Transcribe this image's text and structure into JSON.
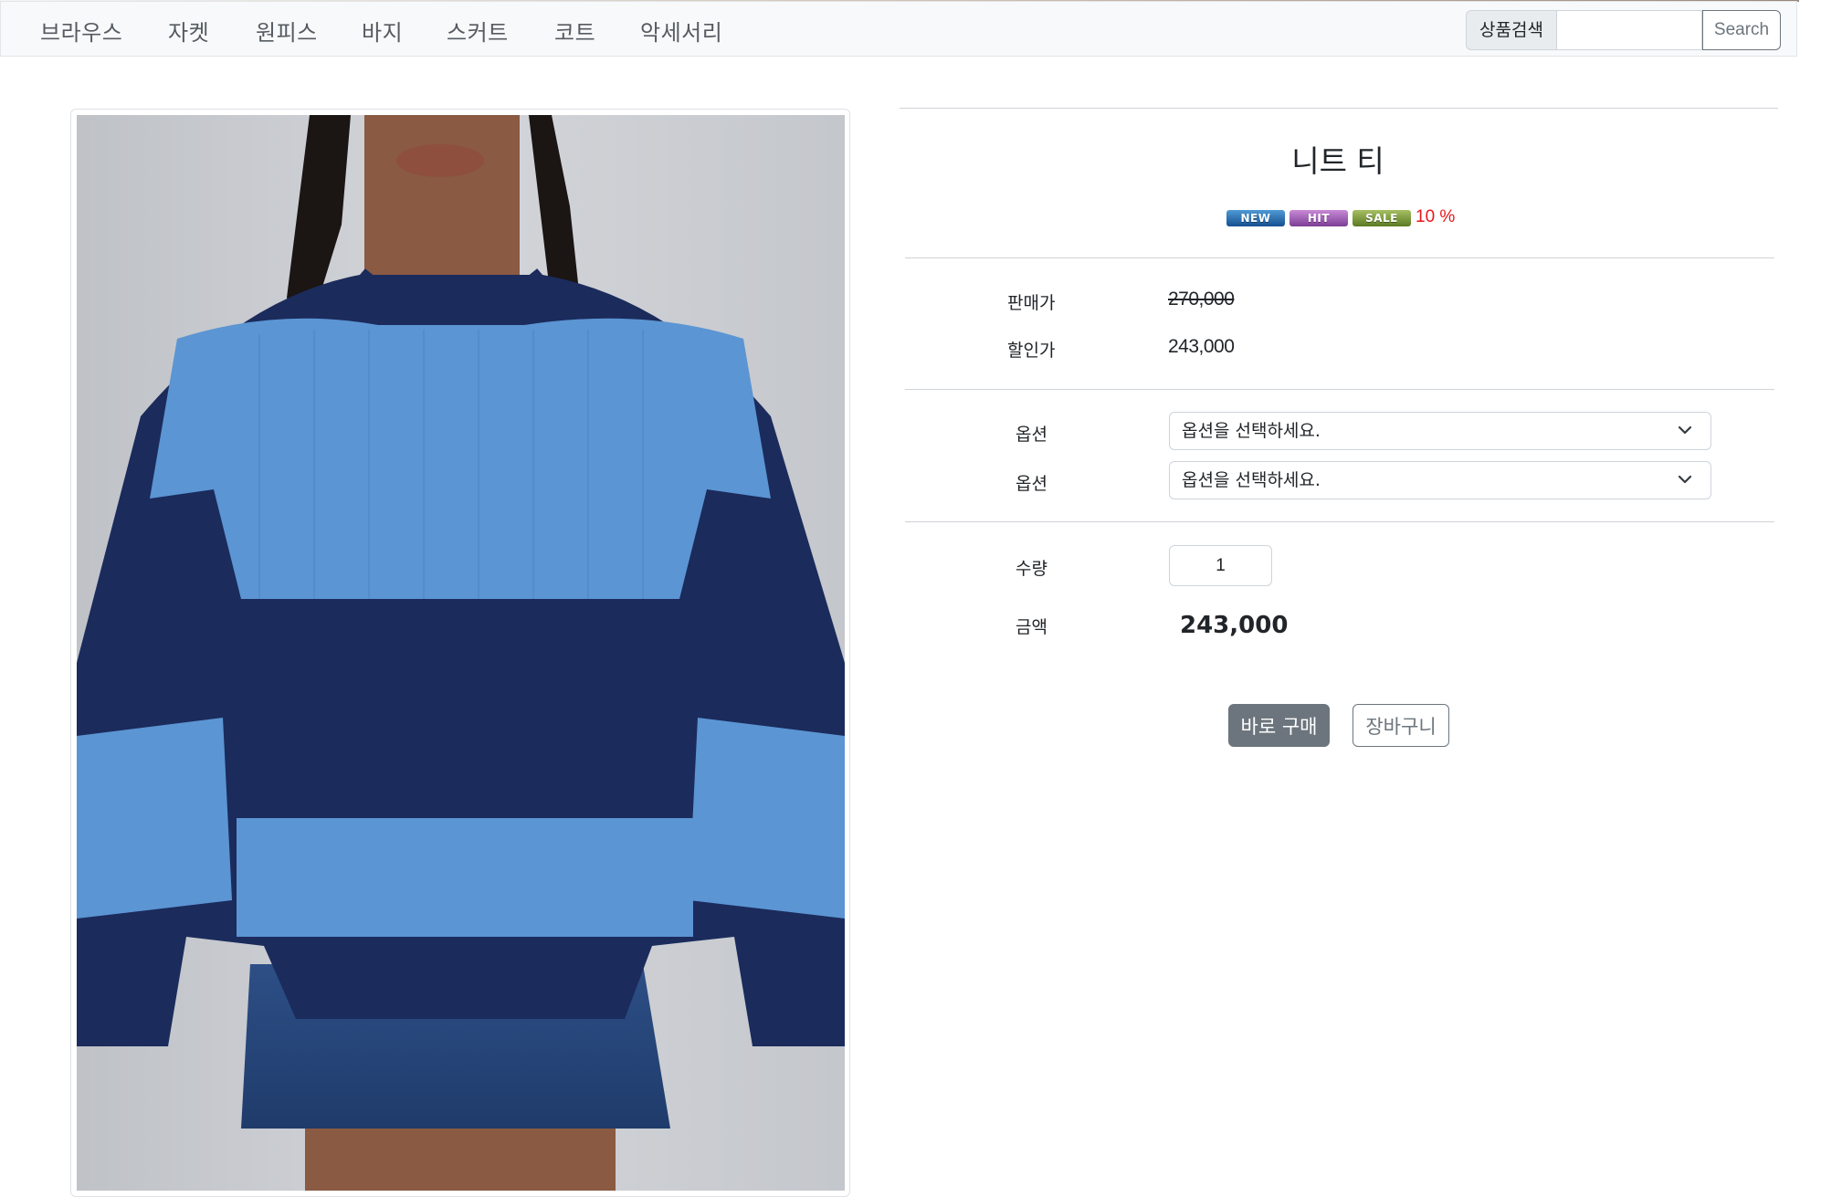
{
  "nav": {
    "items": [
      {
        "label": "브라우스"
      },
      {
        "label": "자켓"
      },
      {
        "label": "원피스"
      },
      {
        "label": "바지"
      },
      {
        "label": "스커트"
      },
      {
        "label": "코트"
      },
      {
        "label": "악세서리"
      }
    ],
    "search_label": "상품검색",
    "search_value": "",
    "search_button": "Search"
  },
  "product": {
    "title": "니트 티",
    "badges": [
      "NEW",
      "HIT",
      "SALE"
    ],
    "discount": "10 %",
    "price_label": "판매가",
    "price": "270,000",
    "sale_price_label": "할인가",
    "sale_price": "243,000",
    "options": [
      {
        "label": "옵션",
        "selected": "옵션을 선택하세요."
      },
      {
        "label": "옵션",
        "selected": "옵션을 선택하세요."
      }
    ],
    "quantity_label": "수량",
    "quantity": "1",
    "amount_label": "금액",
    "amount": "243,000",
    "buy_button": "바로 구매",
    "cart_button": "장바구니"
  },
  "colors": {
    "navbar_bg": "#f8f9fa",
    "discount": "#e8161c",
    "secondary": "#6c757d"
  },
  "icons": {
    "select_arrow": "chevron-down-icon",
    "product_image": "product-photo"
  }
}
